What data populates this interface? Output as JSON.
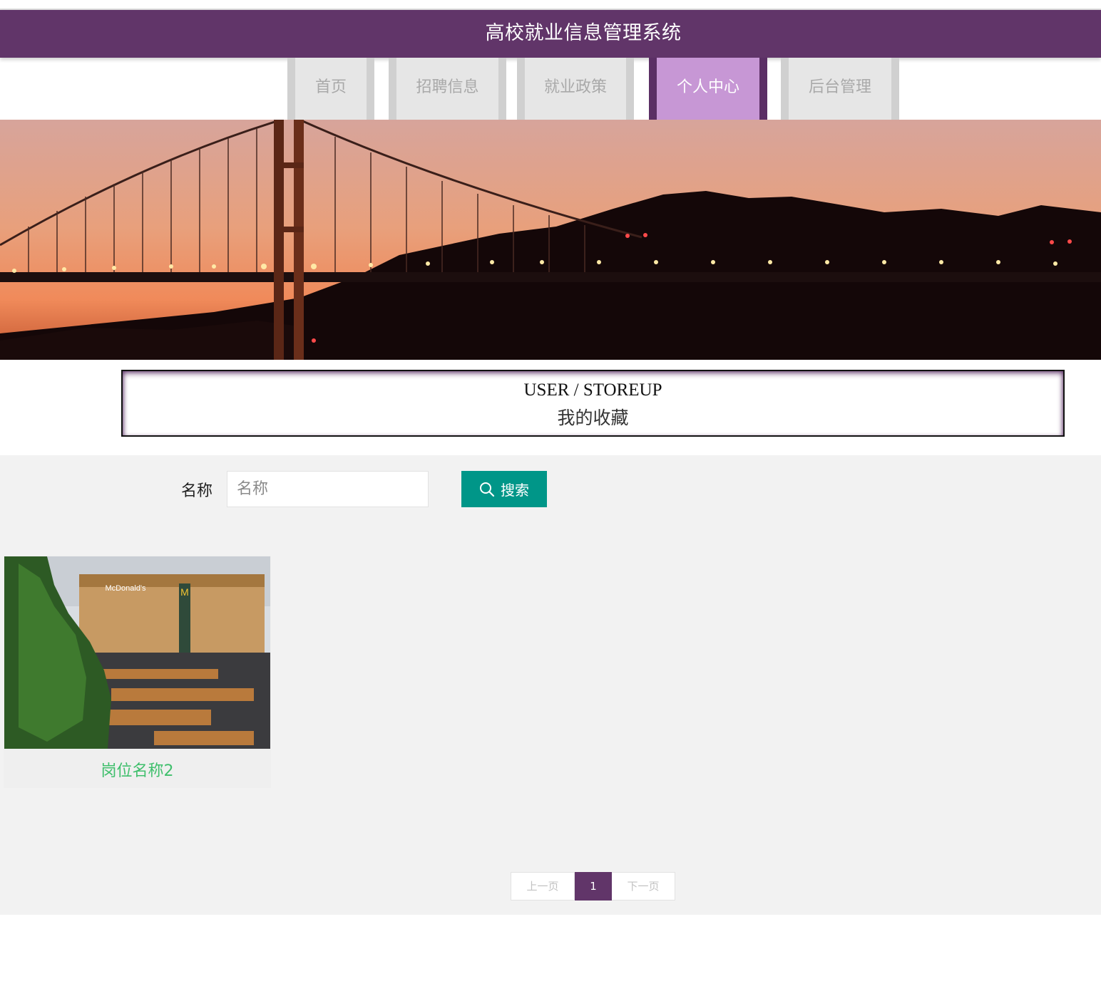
{
  "header": {
    "title": "高校就业信息管理系统"
  },
  "nav": {
    "items": [
      {
        "label": "首页"
      },
      {
        "label": "招聘信息"
      },
      {
        "label": "就业政策"
      },
      {
        "label": "个人中心"
      },
      {
        "label": "后台管理"
      }
    ],
    "active": "个人中心"
  },
  "page_title": {
    "en": "USER / STOREUP",
    "cn": "我的收藏"
  },
  "search": {
    "label": "名称",
    "placeholder": "名称",
    "value": "",
    "button_label": "搜索"
  },
  "items": [
    {
      "title": "岗位名称2"
    }
  ],
  "pagination": {
    "prev": "上一页",
    "current": "1",
    "next": "下一页"
  },
  "colors": {
    "header": "#613569",
    "active_tab": "#c797d5",
    "search_button": "#009688",
    "item_title": "#3fbf6c"
  }
}
